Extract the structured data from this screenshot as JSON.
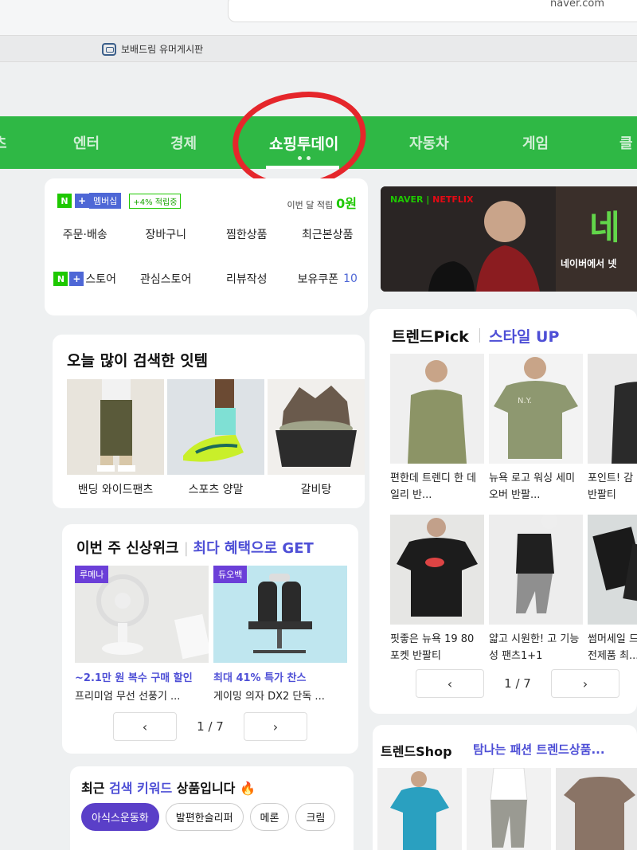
{
  "browser": {
    "url": "naver.com",
    "bookmark": "보배드림 유머게시판"
  },
  "nav": {
    "items": [
      "츠",
      "엔터",
      "경제",
      "쇼핑투데이",
      "자동차",
      "게임",
      "클"
    ],
    "active": "쇼핑투데이"
  },
  "membership": {
    "n": "N",
    "plus": "+",
    "label": "멤버십",
    "earn": "+4% 적립중",
    "month_label": "이번 달 적립",
    "month_value": "0원",
    "menu": [
      "주문·배송",
      "장바구니",
      "찜한상품",
      "최근본상품",
      "스토어",
      "관심스토어",
      "리뷰작성",
      "보유쿠폰"
    ],
    "coupon_count": "10"
  },
  "searched": {
    "title": "오늘 많이 검색한 잇템",
    "items": [
      "밴딩 와이드팬츠",
      "스포츠 양말",
      "갈비탕"
    ]
  },
  "new_arrivals": {
    "title": "이번 주 신상위크",
    "subtitle": "최다 혜택으로 GET",
    "items": [
      {
        "tag": "루메나",
        "promo": "~2.1만 원 복수 구매 할인",
        "name": "프리미엄 무선 선풍기 ..."
      },
      {
        "tag": "듀오백",
        "promo": "최대 41% 특가 찬스",
        "name": "게이밍 의자 DX2 단독 ..."
      }
    ],
    "page": "1 / 7"
  },
  "keywords": {
    "title_pre": "최근",
    "title_accent": "검색 키워드",
    "title_post": "상품입니다 🔥",
    "chips": [
      "아식스운동화",
      "발편한슬리퍼",
      "메론",
      "크림"
    ]
  },
  "banner": {
    "brand_naver": "NAVER",
    "brand_netflix": "NETFLIX",
    "text": "네이버에서 넷",
    "big": "네"
  },
  "trend_pick": {
    "title": "트렌드Pick",
    "subtitle": "스타일 UP",
    "items": [
      "편한데 트렌디 한 데일리 반...",
      "뉴욕 로고 워싱 세미오버 반팔...",
      "포인트! 감 리팅 반팔티",
      "핏좋은 뉴욕 19 80 포켓 반팔티",
      "얇고 시원한! 고 기능성 팬츠1+1",
      "썸머세일 드로 즈 전제품 최..."
    ],
    "page": "1 / 7"
  },
  "trend_shop": {
    "title": "트렌드Shop",
    "subtitle": "탐나는 패션 트렌드상품..."
  },
  "icons": {
    "prev": "‹",
    "next": "›"
  }
}
